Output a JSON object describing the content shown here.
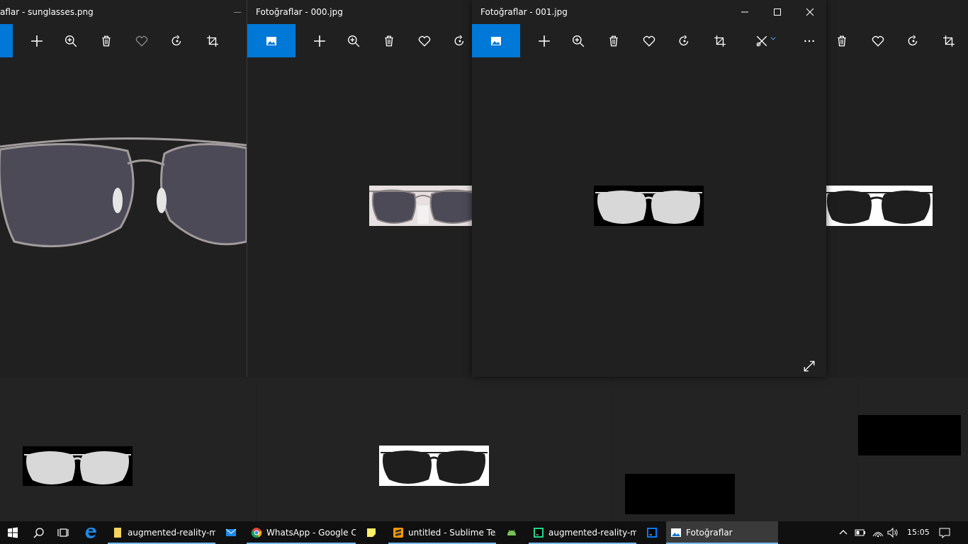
{
  "windows": {
    "bg_top_left": {
      "title": "aflar - sunglasses.png"
    },
    "win_000": {
      "title": "Fotoğraflar - 000.jpg"
    },
    "win_001": {
      "title": "Fotoğraflar - 001.jpg"
    }
  },
  "taskbar": {
    "apps": [
      {
        "label": "augmented-reality-m...",
        "icon": "folder-icon"
      },
      {
        "label": "",
        "icon": "mail-icon"
      },
      {
        "label": "WhatsApp - Google C...",
        "icon": "chrome-icon"
      },
      {
        "label": "",
        "icon": "sticky-notes-icon"
      },
      {
        "label": "untitled - Sublime Tex...",
        "icon": "sublime-icon"
      },
      {
        "label": "",
        "icon": "android-icon"
      },
      {
        "label": "augmented-reality-m...",
        "icon": "pycharm-icon"
      },
      {
        "label": "",
        "icon": "intellij-icon"
      },
      {
        "label": "Fotoğraflar",
        "icon": "photos-icon"
      }
    ],
    "clock": "15:05"
  },
  "colors": {
    "accent": "#0078d7",
    "window_bg": "#202020",
    "taskbar_bg": "#101010"
  }
}
